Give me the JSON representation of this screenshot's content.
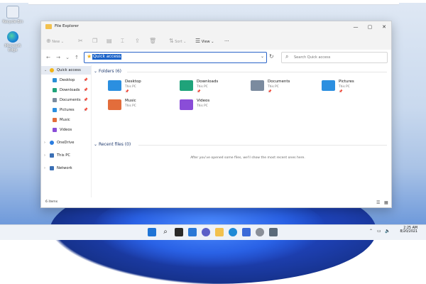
{
  "desktop": {
    "icons": [
      {
        "label": "Recycle Bin"
      },
      {
        "label": "Microsoft Edge"
      }
    ]
  },
  "window": {
    "title": "File Explorer",
    "controls": {
      "minimize": "—",
      "maximize": "▢",
      "close": "✕"
    }
  },
  "toolbar": {
    "new_label": "New",
    "sort_label": "Sort",
    "view_label": "View",
    "more_label": "···"
  },
  "address": {
    "value": "Quick access",
    "search_placeholder": "Search Quick access"
  },
  "sidebar": {
    "items": [
      {
        "label": "Quick access",
        "color": "#f2b518",
        "pinned": false,
        "expand": "⌄"
      },
      {
        "label": "Desktop",
        "color": "#2a8fd6",
        "pinned": true
      },
      {
        "label": "Downloads",
        "color": "#1fa37a",
        "pinned": true
      },
      {
        "label": "Documents",
        "color": "#7b8b9f",
        "pinned": true
      },
      {
        "label": "Pictures",
        "color": "#2b8fe0",
        "pinned": true
      },
      {
        "label": "Music",
        "color": "#e36d3b",
        "pinned": false
      },
      {
        "label": "Videos",
        "color": "#8a4dd8",
        "pinned": false
      },
      {
        "label": "OneDrive",
        "color": "#2b7de0",
        "pinned": false,
        "expand": "›"
      },
      {
        "label": "This PC",
        "color": "#3a6fb5",
        "pinned": false,
        "expand": "›"
      },
      {
        "label": "Network",
        "color": "#3a6fb5",
        "pinned": false,
        "expand": "›"
      }
    ]
  },
  "main": {
    "folders_header": "Folders (6)",
    "folders": [
      {
        "name": "Desktop",
        "sub": "This PC",
        "color": "#2b8fe0",
        "pinned": true
      },
      {
        "name": "Downloads",
        "sub": "This PC",
        "color": "#1fa37a",
        "pinned": true
      },
      {
        "name": "Documents",
        "sub": "This PC",
        "color": "#7b8b9f",
        "pinned": true
      },
      {
        "name": "Pictures",
        "sub": "This PC",
        "color": "#2b8fe0",
        "pinned": true
      },
      {
        "name": "Music",
        "sub": "This PC",
        "color": "#e36d3b",
        "pinned": false
      },
      {
        "name": "Videos",
        "sub": "This PC",
        "color": "#8a4dd8",
        "pinned": false
      }
    ],
    "recent_header": "Recent files (0)",
    "recent_empty": "After you've opened some files, we'll show the most recent ones here."
  },
  "status": {
    "text": "6 items"
  },
  "taskbar": {
    "time": "2:25 AM",
    "date": "8/20/2021"
  }
}
